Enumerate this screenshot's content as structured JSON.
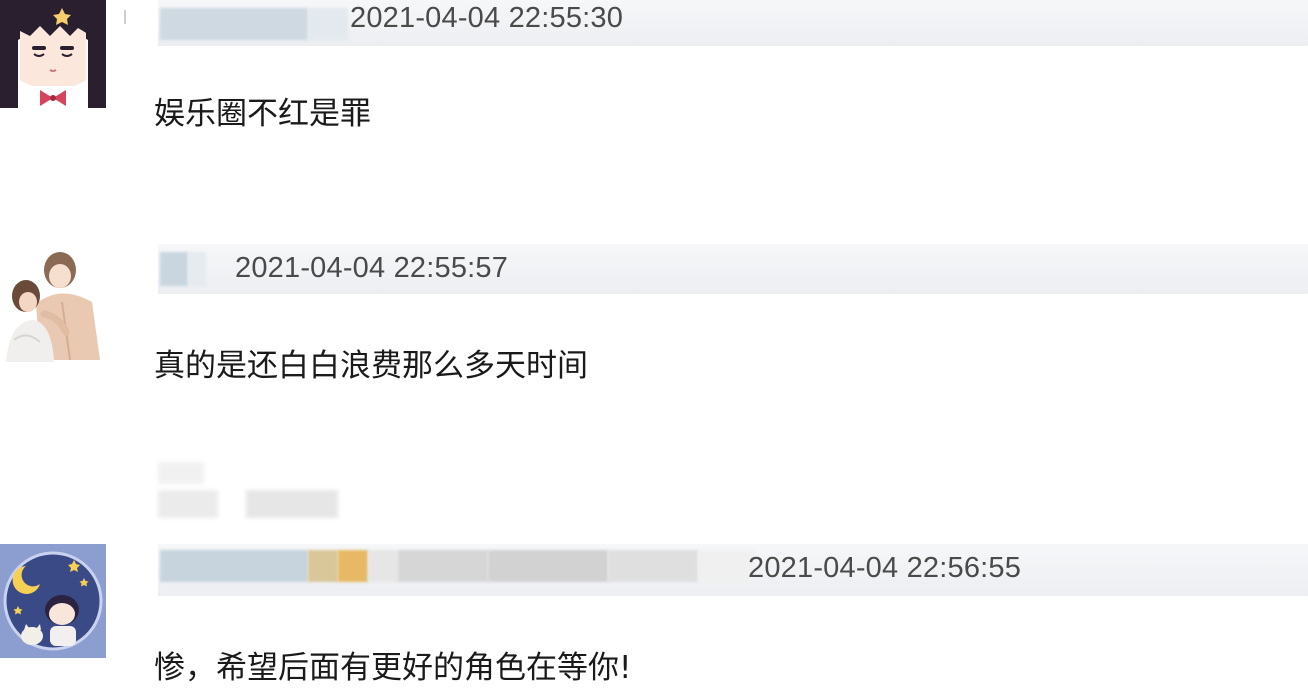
{
  "comments": [
    {
      "timestamp": "2021-04-04 22:55:30",
      "text": "娱乐圈不红是罪",
      "avatar_icon": "anime-girl-avatar-icon"
    },
    {
      "timestamp": "2021-04-04 22:55:57",
      "text": "真的是还白白浪费那么多天时间",
      "avatar_icon": "couple-illustration-avatar-icon"
    },
    {
      "timestamp": "2021-04-04 22:56:55",
      "text": "惨，希望后面有更好的角色在等你!",
      "avatar_icon": "moon-stars-cat-avatar-icon"
    }
  ],
  "colors": {
    "meta_band": "#eceef1",
    "timestamp_text": "#4a4a4a",
    "body_text": "#1a1a1a",
    "blur_blue": "#c9d6e0",
    "blur_gold": "#e6b964",
    "blur_gray": "#d7d7d7"
  }
}
